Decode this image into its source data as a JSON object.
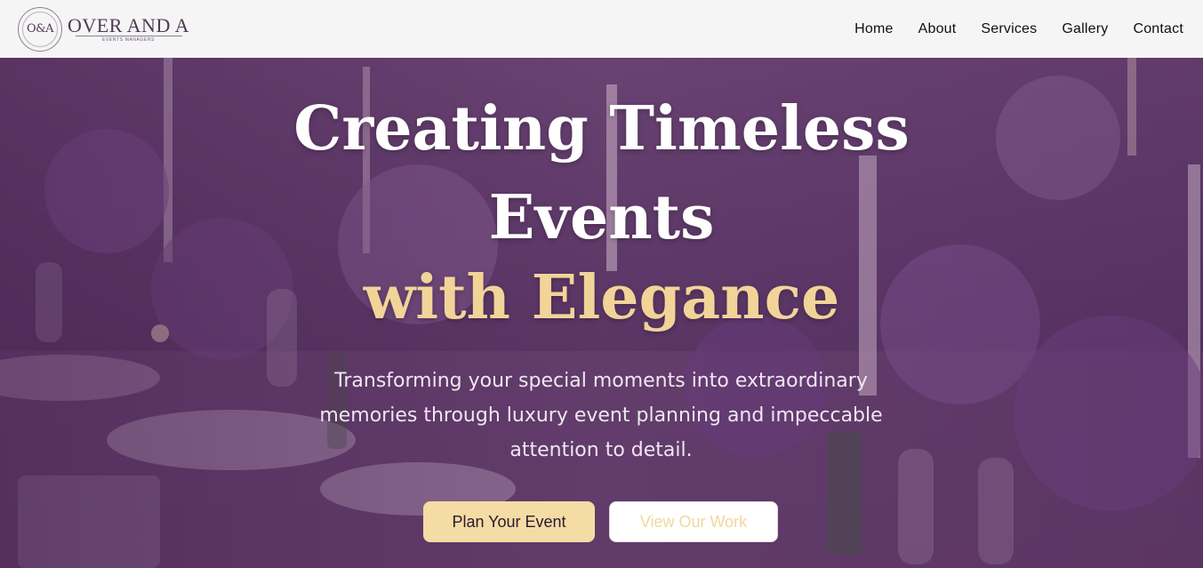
{
  "brand": {
    "monogram": "O&A",
    "name": "OVER AND A",
    "tagline": "EVENTS MANAGERS"
  },
  "nav": {
    "items": [
      "Home",
      "About",
      "Services",
      "Gallery",
      "Contact"
    ]
  },
  "hero": {
    "title_line1": "Creating Timeless",
    "title_line2": "Events",
    "title_accent": "with Elegance",
    "subtitle": "Transforming your special moments into extraordinary memories through luxury event planning and impeccable attention to detail.",
    "primary_button": "Plan Your Event",
    "secondary_button": "View Our Work"
  },
  "colors": {
    "accent": "#f2d499",
    "overlay": "#5d3a68",
    "header_bg": "#f6f5f6"
  }
}
